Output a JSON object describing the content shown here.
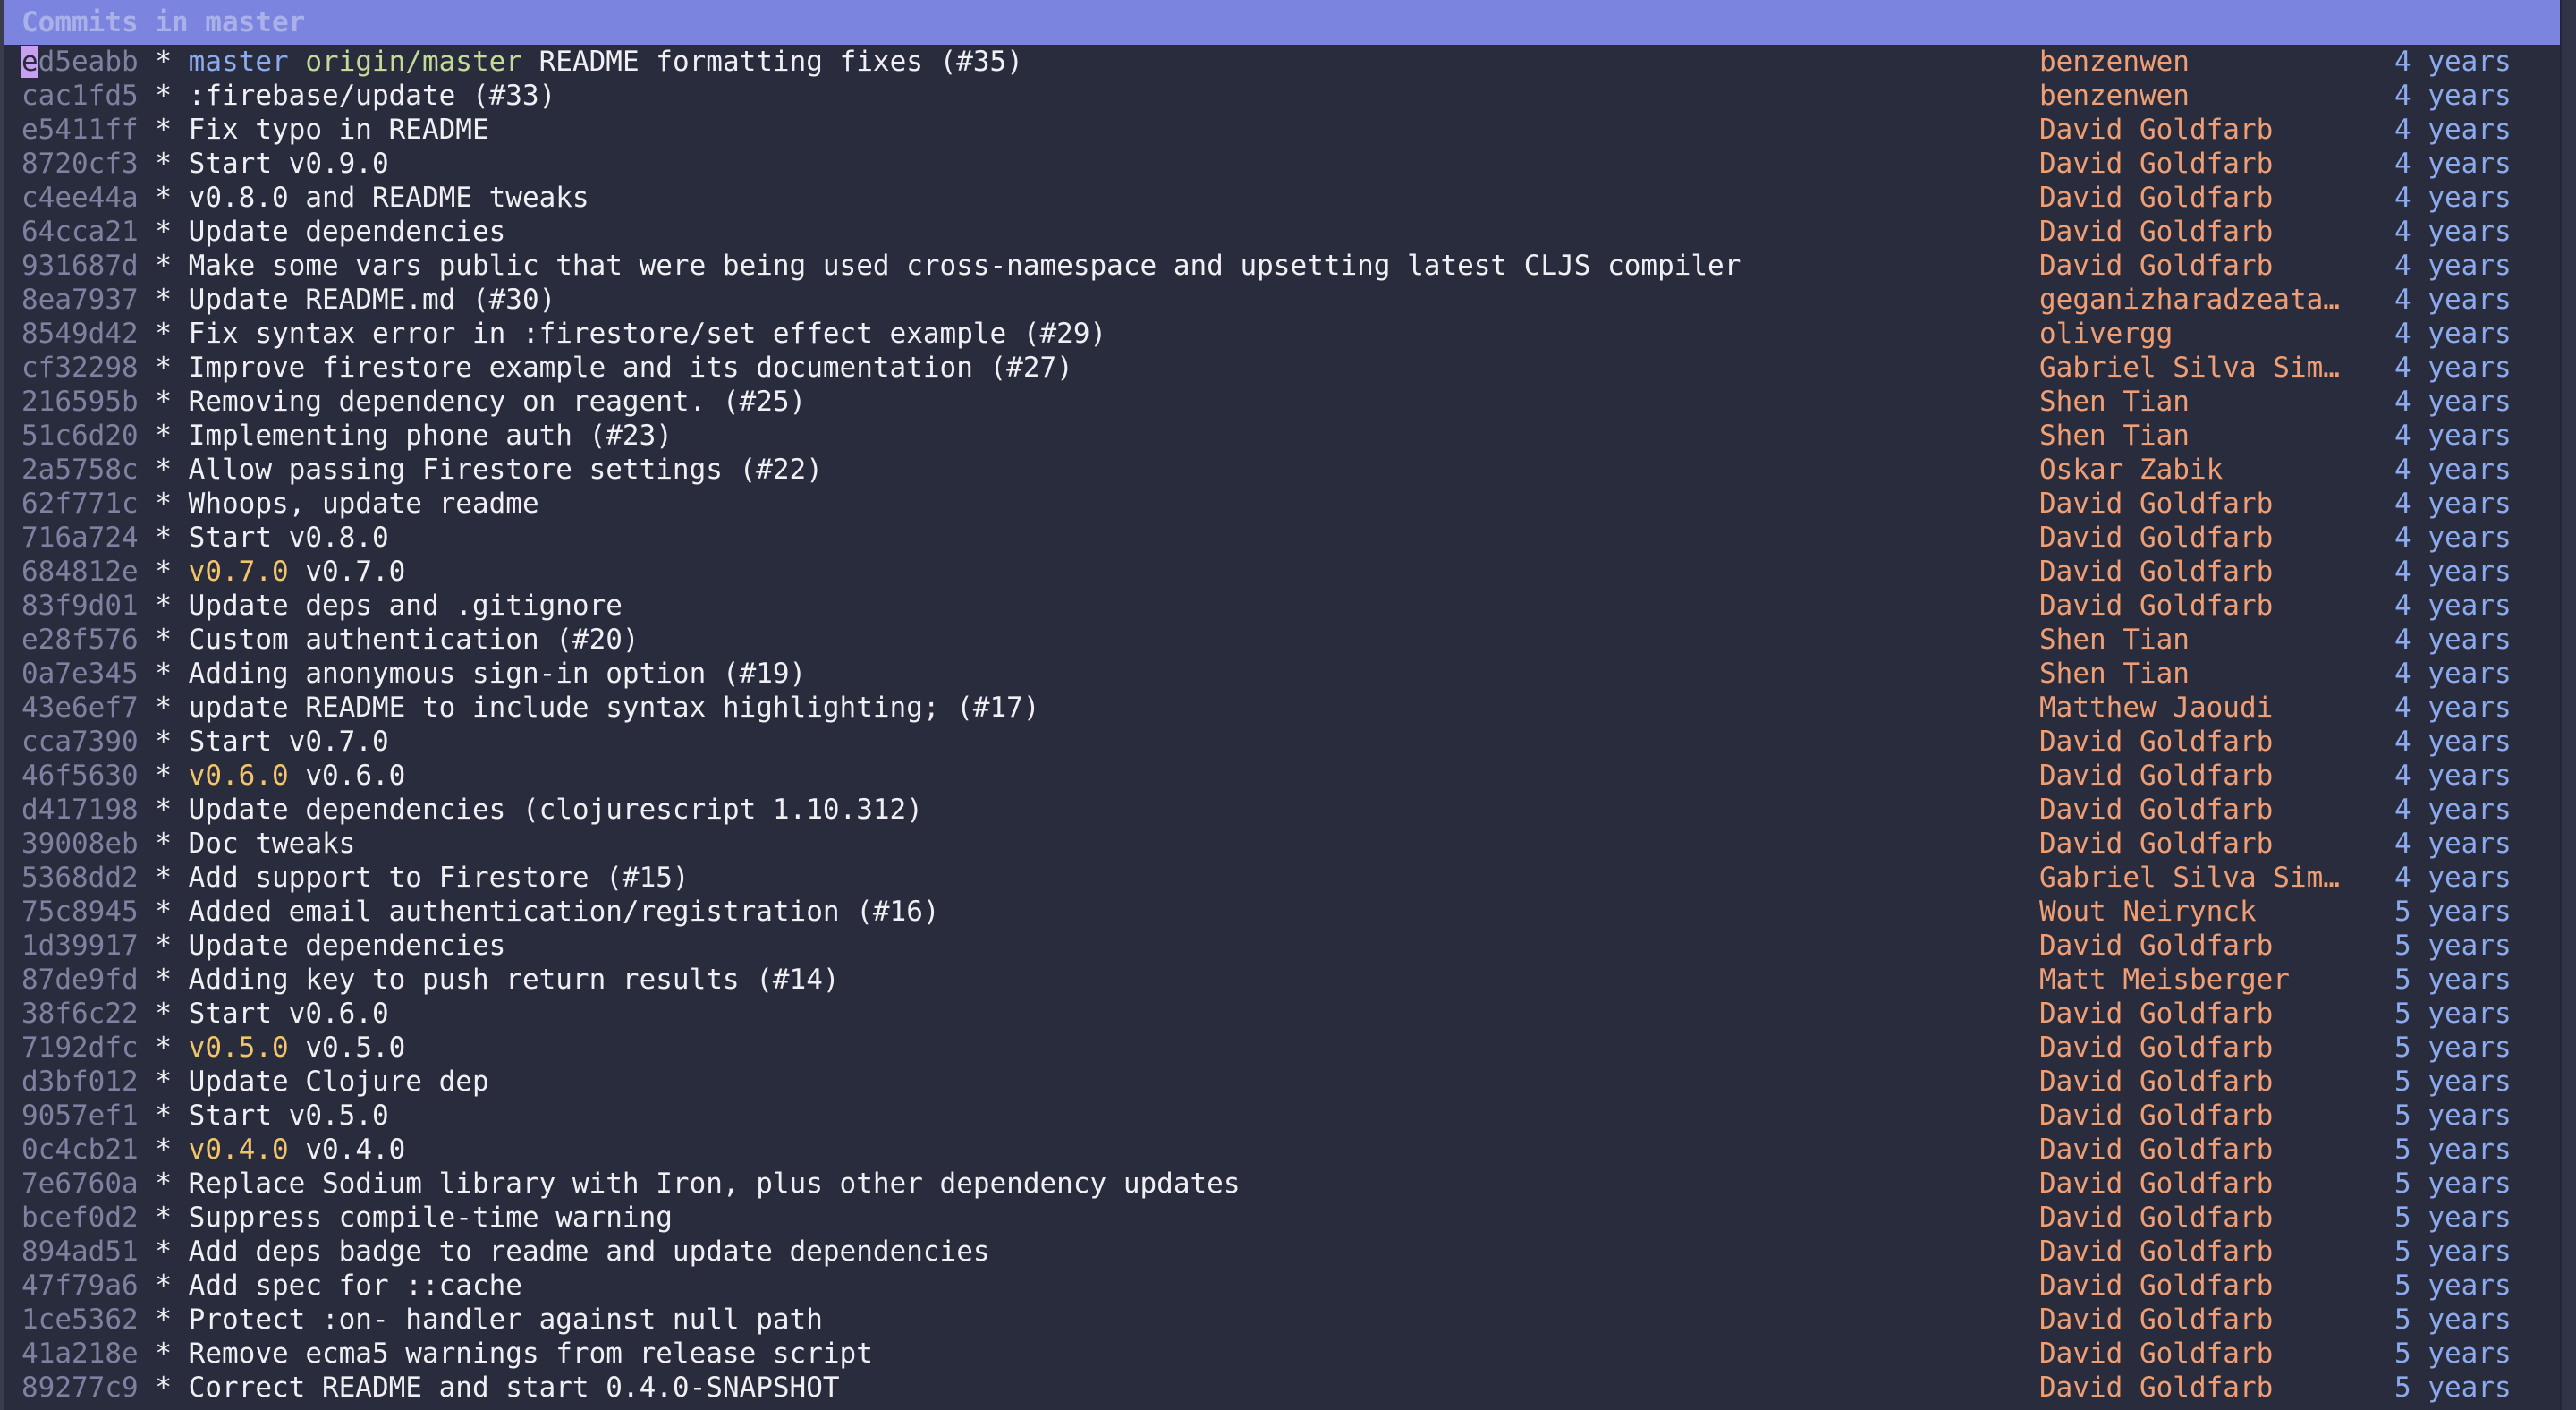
{
  "header": {
    "title": "Commits in master"
  },
  "colors": {
    "header_bg": "#7b84de",
    "background": "#292c3c",
    "hash": "#7e819f",
    "author": "#ef9f76",
    "date": "#8caaee",
    "local_branch": "#8caaee",
    "remote_branch": "#c2dc98",
    "tag": "#f2c46b",
    "cursor": "#c9a0f0"
  },
  "commits": [
    {
      "hash": "ed5eabb",
      "graph": "*",
      "refs": [
        {
          "name": "master",
          "kind": "local"
        },
        {
          "name": "origin/master",
          "kind": "remote"
        }
      ],
      "message": "README formatting fixes (#35)",
      "author": "benzenwen",
      "date": "4 years",
      "selected": true
    },
    {
      "hash": "cac1fd5",
      "graph": "*",
      "refs": [],
      "message": ":firebase/update (#33)",
      "author": "benzenwen",
      "date": "4 years"
    },
    {
      "hash": "e5411ff",
      "graph": "*",
      "refs": [],
      "message": "Fix typo in README",
      "author": "David Goldfarb",
      "date": "4 years"
    },
    {
      "hash": "8720cf3",
      "graph": "*",
      "refs": [],
      "message": "Start v0.9.0",
      "author": "David Goldfarb",
      "date": "4 years"
    },
    {
      "hash": "c4ee44a",
      "graph": "*",
      "refs": [],
      "message": "v0.8.0 and README tweaks",
      "author": "David Goldfarb",
      "date": "4 years"
    },
    {
      "hash": "64cca21",
      "graph": "*",
      "refs": [],
      "message": "Update dependencies",
      "author": "David Goldfarb",
      "date": "4 years"
    },
    {
      "hash": "931687d",
      "graph": "*",
      "refs": [],
      "message": "Make some vars public that were being used cross-namespace and upsetting latest CLJS compiler",
      "author": "David Goldfarb",
      "date": "4 years"
    },
    {
      "hash": "8ea7937",
      "graph": "*",
      "refs": [],
      "message": "Update README.md (#30)",
      "author": "geganizharadzeata…",
      "date": "4 years"
    },
    {
      "hash": "8549d42",
      "graph": "*",
      "refs": [],
      "message": "Fix syntax error in :firestore/set effect example (#29)",
      "author": "olivergg",
      "date": "4 years"
    },
    {
      "hash": "cf32298",
      "graph": "*",
      "refs": [],
      "message": "Improve firestore example and its documentation (#27)",
      "author": "Gabriel Silva Sim…",
      "date": "4 years"
    },
    {
      "hash": "216595b",
      "graph": "*",
      "refs": [],
      "message": "Removing dependency on reagent. (#25)",
      "author": "Shen Tian",
      "date": "4 years"
    },
    {
      "hash": "51c6d20",
      "graph": "*",
      "refs": [],
      "message": "Implementing phone auth (#23)",
      "author": "Shen Tian",
      "date": "4 years"
    },
    {
      "hash": "2a5758c",
      "graph": "*",
      "refs": [],
      "message": "Allow passing Firestore settings (#22)",
      "author": "Oskar Zabik",
      "date": "4 years"
    },
    {
      "hash": "62f771c",
      "graph": "*",
      "refs": [],
      "message": "Whoops, update readme",
      "author": "David Goldfarb",
      "date": "4 years"
    },
    {
      "hash": "716a724",
      "graph": "*",
      "refs": [],
      "message": "Start v0.8.0",
      "author": "David Goldfarb",
      "date": "4 years"
    },
    {
      "hash": "684812e",
      "graph": "*",
      "refs": [
        {
          "name": "v0.7.0",
          "kind": "tag"
        }
      ],
      "message": "v0.7.0",
      "author": "David Goldfarb",
      "date": "4 years"
    },
    {
      "hash": "83f9d01",
      "graph": "*",
      "refs": [],
      "message": "Update deps and .gitignore",
      "author": "David Goldfarb",
      "date": "4 years"
    },
    {
      "hash": "e28f576",
      "graph": "*",
      "refs": [],
      "message": "Custom authentication (#20)",
      "author": "Shen Tian",
      "date": "4 years"
    },
    {
      "hash": "0a7e345",
      "graph": "*",
      "refs": [],
      "message": "Adding anonymous sign-in option (#19)",
      "author": "Shen Tian",
      "date": "4 years"
    },
    {
      "hash": "43e6ef7",
      "graph": "*",
      "refs": [],
      "message": "update README to include syntax highlighting; (#17)",
      "author": "Matthew Jaoudi",
      "date": "4 years"
    },
    {
      "hash": "cca7390",
      "graph": "*",
      "refs": [],
      "message": "Start v0.7.0",
      "author": "David Goldfarb",
      "date": "4 years"
    },
    {
      "hash": "46f5630",
      "graph": "*",
      "refs": [
        {
          "name": "v0.6.0",
          "kind": "tag"
        }
      ],
      "message": "v0.6.0",
      "author": "David Goldfarb",
      "date": "4 years"
    },
    {
      "hash": "d417198",
      "graph": "*",
      "refs": [],
      "message": "Update dependencies (clojurescript 1.10.312)",
      "author": "David Goldfarb",
      "date": "4 years"
    },
    {
      "hash": "39008eb",
      "graph": "*",
      "refs": [],
      "message": "Doc tweaks",
      "author": "David Goldfarb",
      "date": "4 years"
    },
    {
      "hash": "5368dd2",
      "graph": "*",
      "refs": [],
      "message": "Add support to Firestore (#15)",
      "author": "Gabriel Silva Sim…",
      "date": "4 years"
    },
    {
      "hash": "75c8945",
      "graph": "*",
      "refs": [],
      "message": "Added email authentication/registration (#16)",
      "author": "Wout Neirynck",
      "date": "5 years"
    },
    {
      "hash": "1d39917",
      "graph": "*",
      "refs": [],
      "message": "Update dependencies",
      "author": "David Goldfarb",
      "date": "5 years"
    },
    {
      "hash": "87de9fd",
      "graph": "*",
      "refs": [],
      "message": "Adding key to push return results (#14)",
      "author": "Matt Meisberger",
      "date": "5 years"
    },
    {
      "hash": "38f6c22",
      "graph": "*",
      "refs": [],
      "message": "Start v0.6.0",
      "author": "David Goldfarb",
      "date": "5 years"
    },
    {
      "hash": "7192dfc",
      "graph": "*",
      "refs": [
        {
          "name": "v0.5.0",
          "kind": "tag"
        }
      ],
      "message": "v0.5.0",
      "author": "David Goldfarb",
      "date": "5 years"
    },
    {
      "hash": "d3bf012",
      "graph": "*",
      "refs": [],
      "message": "Update Clojure dep",
      "author": "David Goldfarb",
      "date": "5 years"
    },
    {
      "hash": "9057ef1",
      "graph": "*",
      "refs": [],
      "message": "Start v0.5.0",
      "author": "David Goldfarb",
      "date": "5 years"
    },
    {
      "hash": "0c4cb21",
      "graph": "*",
      "refs": [
        {
          "name": "v0.4.0",
          "kind": "tag"
        }
      ],
      "message": "v0.4.0",
      "author": "David Goldfarb",
      "date": "5 years"
    },
    {
      "hash": "7e6760a",
      "graph": "*",
      "refs": [],
      "message": "Replace Sodium library with Iron, plus other dependency updates",
      "author": "David Goldfarb",
      "date": "5 years"
    },
    {
      "hash": "bcef0d2",
      "graph": "*",
      "refs": [],
      "message": "Suppress compile-time warning",
      "author": "David Goldfarb",
      "date": "5 years"
    },
    {
      "hash": "894ad51",
      "graph": "*",
      "refs": [],
      "message": "Add deps badge to readme and update dependencies",
      "author": "David Goldfarb",
      "date": "5 years"
    },
    {
      "hash": "47f79a6",
      "graph": "*",
      "refs": [],
      "message": "Add spec for ::cache",
      "author": "David Goldfarb",
      "date": "5 years"
    },
    {
      "hash": "1ce5362",
      "graph": "*",
      "refs": [],
      "message": "Protect :on- handler against null path",
      "author": "David Goldfarb",
      "date": "5 years"
    },
    {
      "hash": "41a218e",
      "graph": "*",
      "refs": [],
      "message": "Remove ecma5 warnings from release script",
      "author": "David Goldfarb",
      "date": "5 years"
    },
    {
      "hash": "89277c9",
      "graph": "*",
      "refs": [],
      "message": "Correct README and start 0.4.0-SNAPSHOT",
      "author": "David Goldfarb",
      "date": "5 years"
    }
  ]
}
